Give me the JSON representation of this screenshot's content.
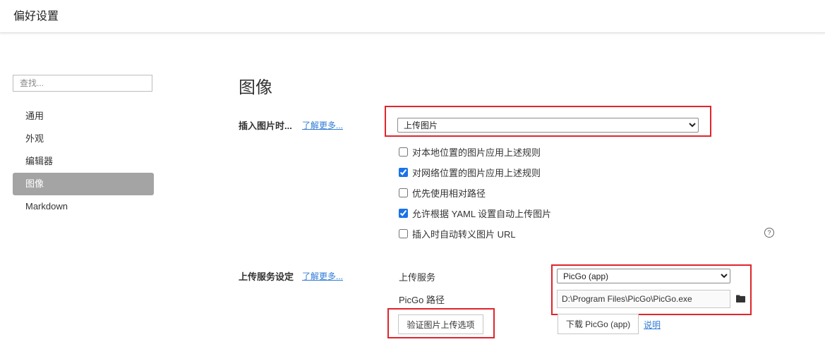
{
  "window": {
    "title": "偏好设置"
  },
  "sidebar": {
    "search_placeholder": "查找...",
    "items": [
      {
        "label": "通用",
        "active": false
      },
      {
        "label": "外观",
        "active": false
      },
      {
        "label": "编辑器",
        "active": false
      },
      {
        "label": "图像",
        "active": true
      },
      {
        "label": "Markdown",
        "active": false
      }
    ]
  },
  "main": {
    "section_title": "图像",
    "insert_image": {
      "label": "插入图片时...",
      "learn_more": "了解更多...",
      "selected_option": "上传图片",
      "options": [
        {
          "label": "对本地位置的图片应用上述规则",
          "checked": false
        },
        {
          "label": "对网络位置的图片应用上述规则",
          "checked": true
        },
        {
          "label": "优先使用相对路径",
          "checked": false
        },
        {
          "label": "允许根据 YAML 设置自动上传图片",
          "checked": true
        },
        {
          "label": "插入时自动转义图片 URL",
          "checked": false
        }
      ],
      "help_icon": "question-circle-icon"
    },
    "upload_service": {
      "label": "上传服务设定",
      "learn_more": "了解更多...",
      "service_label": "上传服务",
      "service_value": "PicGo (app)",
      "path_label": "PicGo 路径",
      "path_value": "D:\\Program Files\\PicGo\\PicGo.exe",
      "folder_icon": "folder-icon",
      "verify_button": "验证图片上传选项",
      "download_button": "下载 PicGo (app)",
      "doc_link": "说明"
    }
  },
  "colors": {
    "highlight": "#e0242b",
    "link": "#2f7bd6",
    "active_nav": "#a4a4a4"
  }
}
